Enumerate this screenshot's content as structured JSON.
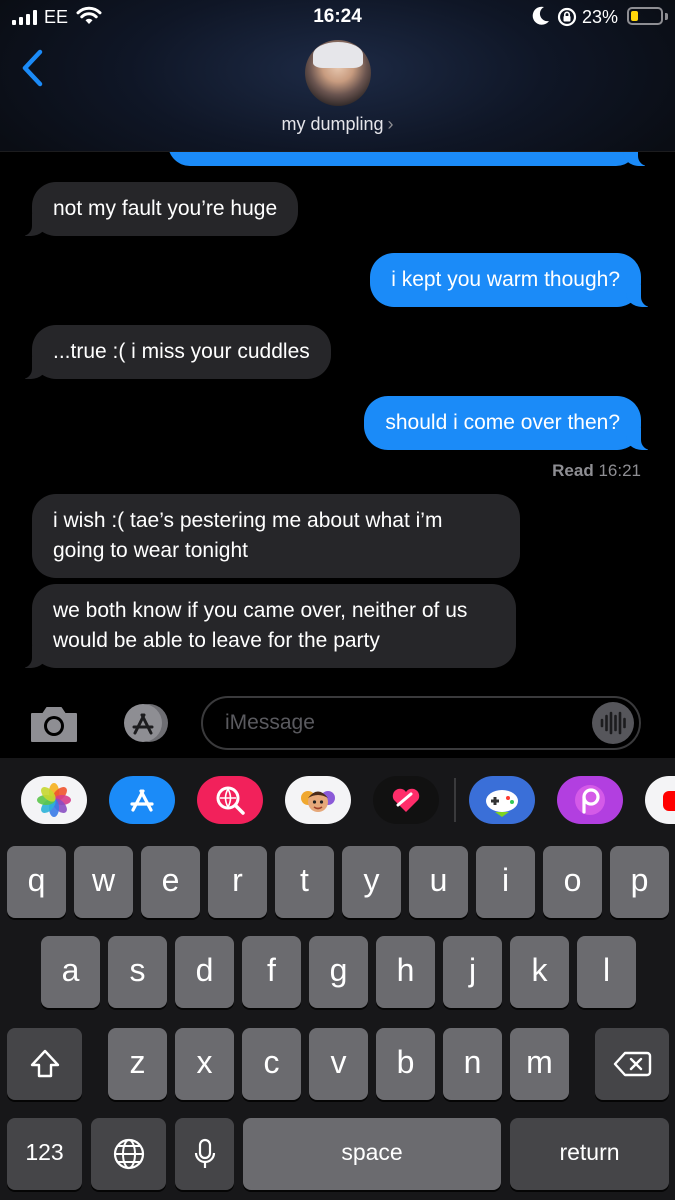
{
  "status_bar": {
    "carrier": "EE",
    "time": "16:24",
    "battery_percent": "23%",
    "battery_level": 0.23,
    "battery_color": "#ffd60a"
  },
  "header": {
    "contact_name": "my dumpling",
    "chevron": "›",
    "back_icon": "chevron-left-icon"
  },
  "messages": [
    {
      "direction": "incoming",
      "text": "not my fault you’re huge"
    },
    {
      "direction": "outgoing",
      "text": "i kept you warm though?"
    },
    {
      "direction": "incoming",
      "text": "...true :( i miss your cuddles"
    },
    {
      "direction": "outgoing",
      "text": "should i come over then?"
    },
    {
      "direction": "incoming",
      "text": "i wish :( tae’s pestering me about what i’m going to wear tonight"
    },
    {
      "direction": "incoming",
      "text": "we both know if you came over, neither of us would be able to leave for the party"
    }
  ],
  "read_receipt": {
    "label": "Read",
    "time": "16:21"
  },
  "input": {
    "placeholder": "iMessage",
    "value": ""
  },
  "app_strip": [
    "photos-icon",
    "app-store-icon",
    "images-search-icon",
    "memoji-icon",
    "digital-touch-icon",
    "game-icon",
    "picsart-icon",
    "youtube-icon"
  ],
  "keyboard": {
    "row1": [
      "q",
      "w",
      "e",
      "r",
      "t",
      "y",
      "u",
      "i",
      "o",
      "p"
    ],
    "row2": [
      "a",
      "s",
      "d",
      "f",
      "g",
      "h",
      "j",
      "k",
      "l"
    ],
    "row3": [
      "z",
      "x",
      "c",
      "v",
      "b",
      "n",
      "m"
    ],
    "numbers_label": "123",
    "space_label": "space",
    "return_label": "return"
  },
  "colors": {
    "outgoing_bubble": "#1b8bf8",
    "incoming_bubble": "#262629",
    "background": "#000000"
  }
}
